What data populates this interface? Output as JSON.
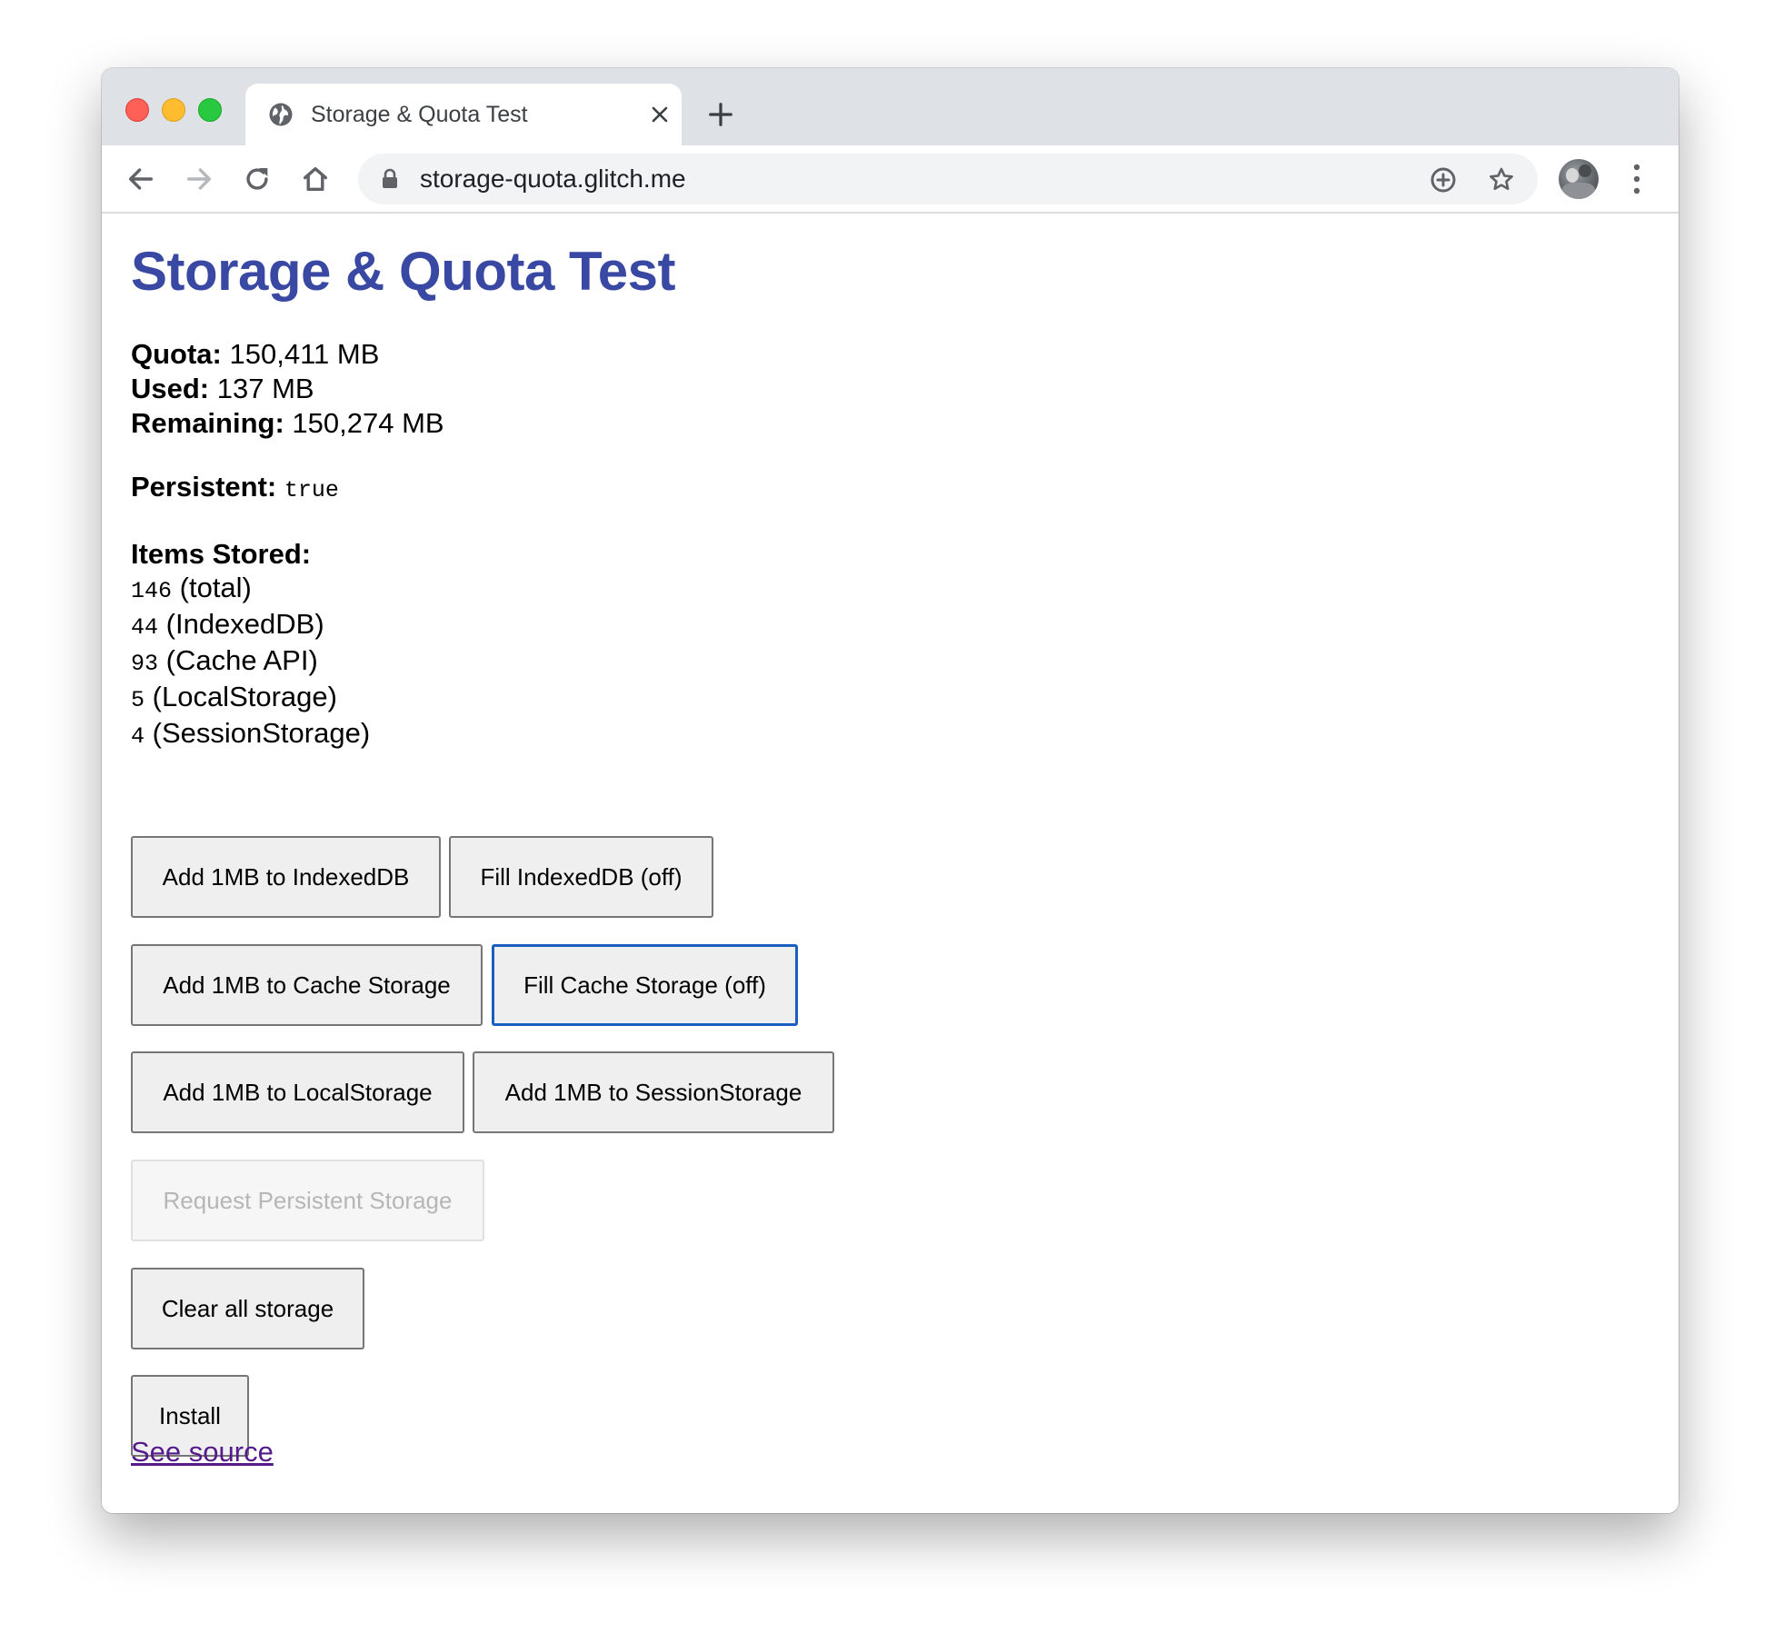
{
  "browser": {
    "tab_title": "Storage & Quota Test",
    "url": "storage-quota.glitch.me"
  },
  "page": {
    "title": "Storage & Quota Test",
    "quota_label": "Quota:",
    "quota_value": "150,411 MB",
    "used_label": "Used:",
    "used_value": "137 MB",
    "remaining_label": "Remaining:",
    "remaining_value": "150,274 MB",
    "persistent_label": "Persistent:",
    "persistent_value": "true",
    "items_label": "Items Stored:",
    "items": [
      {
        "count": "146",
        "label": "(total)"
      },
      {
        "count": "44",
        "label": "(IndexedDB)"
      },
      {
        "count": "93",
        "label": "(Cache API)"
      },
      {
        "count": "5",
        "label": "(LocalStorage)"
      },
      {
        "count": "4",
        "label": "(SessionStorage)"
      }
    ],
    "buttons": {
      "add_idb": "Add 1MB to IndexedDB",
      "fill_idb": "Fill IndexedDB (off)",
      "add_cache": "Add 1MB to Cache Storage",
      "fill_cache": "Fill Cache Storage (off)",
      "add_local": "Add 1MB to LocalStorage",
      "add_session": "Add 1MB to SessionStorage",
      "request_persistent": "Request Persistent Storage",
      "clear_all": "Clear all storage",
      "install": "Install"
    },
    "see_source": "See source"
  },
  "colors": {
    "title": "#3948a3",
    "focus_ring": "#1a5fbd",
    "visited_link": "#551a8b"
  }
}
